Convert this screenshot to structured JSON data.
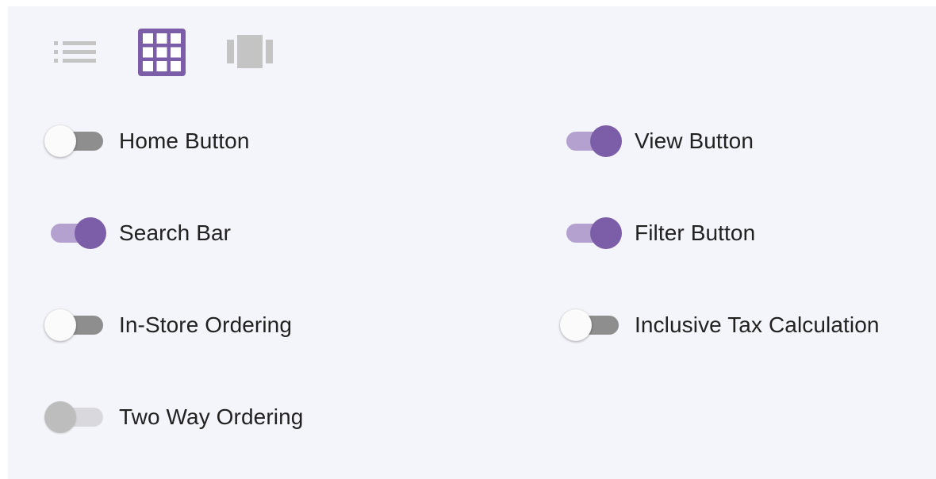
{
  "view_toolbar": {
    "modes": [
      {
        "icon": "list-view-icon",
        "active": false
      },
      {
        "icon": "grid-view-icon",
        "active": true
      },
      {
        "icon": "carousel-view-icon",
        "active": false
      }
    ],
    "active_color": "#7b5ea7",
    "inactive_color": "#c4c4c4"
  },
  "toggles": [
    {
      "label": "Home Button",
      "state": "off"
    },
    {
      "label": "View Button",
      "state": "on"
    },
    {
      "label": "Search Bar",
      "state": "on"
    },
    {
      "label": "Filter Button",
      "state": "on"
    },
    {
      "label": "In-Store Ordering",
      "state": "off"
    },
    {
      "label": "Inclusive Tax Calculation",
      "state": "off"
    },
    {
      "label": "Two Way Ordering",
      "state": "disabled"
    }
  ],
  "colors": {
    "accent": "#7b5ea7",
    "accent_track": "#b4a1cf",
    "background": "#f4f5fa",
    "off_track": "#8e8e8e",
    "disabled_thumb": "#bdbdbd"
  }
}
